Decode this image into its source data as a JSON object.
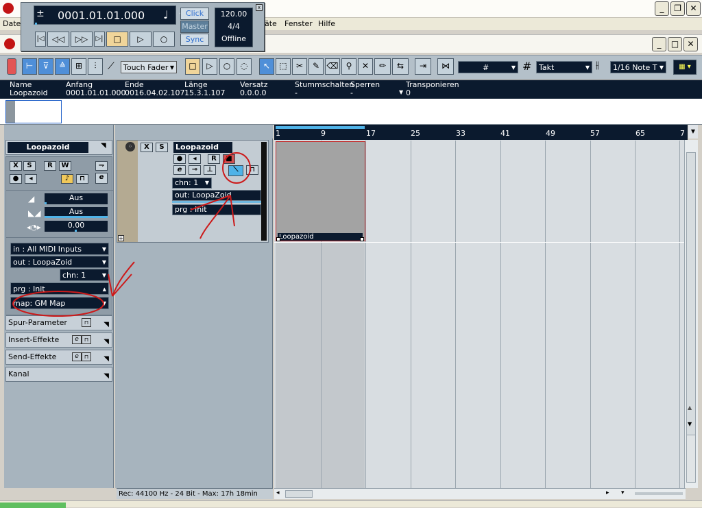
{
  "menu": {
    "items": [
      "Date",
      "äte",
      "Fenster",
      "Hilfe"
    ]
  },
  "transport": {
    "position": "0001.01.01.000",
    "sign": "±",
    "note_icon": "♩",
    "buttons": {
      "click": "Click",
      "master": "Master",
      "sync": "Sync"
    },
    "tempo": "120.00",
    "signature": "4/4",
    "status": "Offline"
  },
  "toolbar": {
    "automation_mode": "Touch Fader",
    "snap_type": "Takt",
    "quantize": "1/16 Note T"
  },
  "info_line": {
    "columns": [
      {
        "label": "Name",
        "value": "Loopazoid"
      },
      {
        "label": "Anfang",
        "value": "0001.01.01.000"
      },
      {
        "label": "Ende",
        "value": "0016.04.02.107"
      },
      {
        "label": "Länge",
        "value": "15.3.1.107"
      },
      {
        "label": "Versatz",
        "value": "0.0.0.0"
      },
      {
        "label": "Stummschalten",
        "value": "-"
      },
      {
        "label": "Sperren",
        "value": "-"
      },
      {
        "label": "Transponieren",
        "value": "0"
      }
    ]
  },
  "inspector": {
    "track_name": "Loopazoid",
    "buttons": {
      "x": "X",
      "s": "S",
      "r": "R",
      "w": "W",
      "e": "e"
    },
    "volume": "Aus",
    "pan": "Aus",
    "delay": "0.00",
    "midi_in": "in : All MIDI Inputs",
    "midi_out": "out : LoopaZoid",
    "channel": "chn: 1",
    "program": "prg : Init",
    "map": "map: GM Map",
    "sections": [
      "Spur-Parameter",
      "Insert-Effekte",
      "Send-Effekte",
      "Kanal"
    ]
  },
  "track": {
    "name": "Loopazoid",
    "buttons": {
      "x": "X",
      "s": "S",
      "r": "R",
      "e": "e"
    },
    "channel": "chn: 1",
    "out": "out: LoopaZoid",
    "program": "prg : Init"
  },
  "ruler": {
    "marks": [
      "1",
      "9",
      "17",
      "25",
      "33",
      "41",
      "49",
      "57",
      "65",
      "7"
    ]
  },
  "part": {
    "name": "Loopazoid"
  },
  "status_bar": {
    "text": "Rec: 44100 Hz - 24 Bit - Max: 17h 18min"
  },
  "colors": {
    "navy": "#0b1a2e",
    "panel": "#a7b4be",
    "arrange_bg": "#d8dde1",
    "part_fill": "#a3a3a3",
    "annotation": "#cc1a1a"
  }
}
